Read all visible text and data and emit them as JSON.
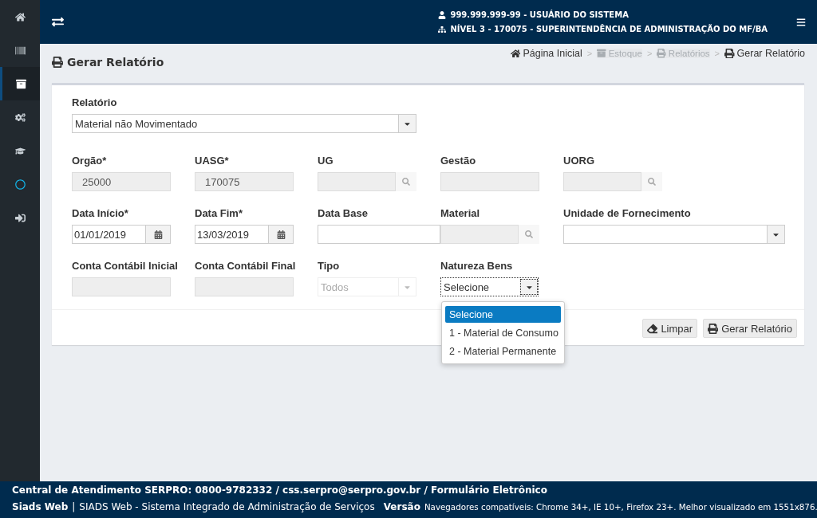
{
  "sidebar": {
    "items": [
      {
        "kind": "home",
        "selected": false
      },
      {
        "kind": "barcode",
        "selected": false
      },
      {
        "kind": "archive",
        "selected": true
      },
      {
        "kind": "cogs",
        "selected": false
      },
      {
        "kind": "graduation",
        "selected": false
      },
      {
        "kind": "circle",
        "selected": false
      },
      {
        "kind": "signin",
        "selected": false
      }
    ]
  },
  "header": {
    "user": "999.999.999-99 - USUÁRIO DO SISTEMA",
    "unit": "NÍVEL 3 - 170075 - SUPERINTENDÊNCIA DE ADMINISTRAÇÃO DO MF/BA"
  },
  "page_title": "Gerar Relatório",
  "breadcrumb": [
    {
      "label": "Página Inicial",
      "disabled": false
    },
    {
      "label": "Estoque",
      "disabled": true
    },
    {
      "label": "Relatórios",
      "disabled": true
    },
    {
      "label": "Gerar Relatório",
      "disabled": false
    }
  ],
  "breadcrumb_separator": ">",
  "report": {
    "label": "Relatório",
    "value": "Material não Movimentado"
  },
  "fields": [
    {
      "label": "Orgão*",
      "kind": "text",
      "value": "25000",
      "disabled": true
    },
    {
      "label": "UASG*",
      "kind": "text",
      "value": "170075",
      "disabled": true
    },
    {
      "label": "UG",
      "kind": "lookup",
      "disabled": true
    },
    {
      "label": "Gestão",
      "kind": "text",
      "disabled": true
    },
    {
      "label": "UORG",
      "kind": "lookup",
      "disabled": true
    },
    {
      "label": "Data Início*",
      "kind": "date",
      "value": "01/01/2019",
      "disabled": false
    },
    {
      "label": "Data Fim*",
      "kind": "date",
      "value": "13/03/2019",
      "disabled": false
    },
    {
      "label": "Data Base",
      "kind": "text",
      "disabled": false
    },
    {
      "label": "Material",
      "kind": "lookup",
      "disabled": true
    },
    {
      "label": "Unidade de Fornecimento",
      "kind": "wide-select",
      "disabled": false
    },
    {
      "label": "Conta Contábil Inicial",
      "kind": "text",
      "disabled": true
    },
    {
      "label": "Conta Contábil Final",
      "kind": "text",
      "disabled": true
    },
    {
      "label": "Tipo",
      "kind": "select",
      "value": "Todos",
      "disabled": true
    },
    {
      "label": "Natureza Bens",
      "kind": "dropdown",
      "value": "Selecione",
      "expanded": true,
      "options": [
        {
          "label": "Selecione",
          "selected": true
        },
        {
          "label": "1 - Material de Consumo",
          "selected": false
        },
        {
          "label": "2 - Material Permanente",
          "selected": false
        }
      ]
    }
  ],
  "buttons": [
    {
      "label": "Limpar"
    },
    {
      "label": "Gerar Relatório"
    }
  ],
  "footer": {
    "contact": "Central de Atendimento SERPRO: 0800-9782332 / css.serpro@serpro.gov.br / Formulário Eletrônico",
    "brand": "Siads Web",
    "separator": "|",
    "system": "SIADS Web - Sistema Integrado de Administração de Serviços",
    "version": "Versão",
    "browsers": "Navegadores compatíveis: Chrome 34+, IE 10+, Firefox 23+. Melhor visualizado em 1551x876."
  }
}
